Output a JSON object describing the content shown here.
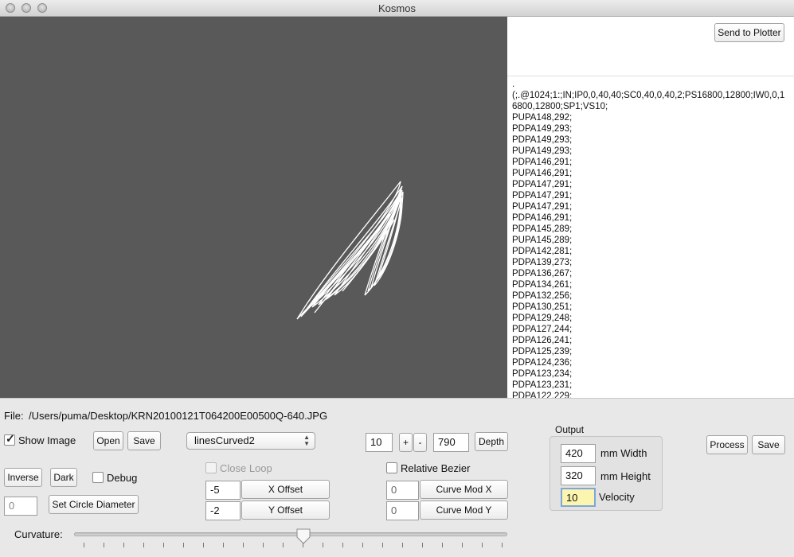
{
  "window": {
    "title": "Kosmos"
  },
  "canvas": {
    "background": "#595959",
    "stroke": "#ffffff"
  },
  "plotter": {
    "send_label": "Send to Plotter"
  },
  "hpgl_output": ".\n(;.@1024;1:;IN;IP0,0,40,40;SC0,40,0,40,2;PS16800,12800;IW0,0,16800,12800;SP1;VS10;\nPUPA148,292;\nPDPA149,293;\nPDPA149,293;\nPUPA149,293;\nPDPA146,291;\nPUPA146,291;\nPDPA147,291;\nPDPA147,291;\nPUPA147,291;\nPDPA146,291;\nPDPA145,289;\nPUPA145,289;\nPDPA142,281;\nPDPA139,273;\nPDPA136,267;\nPDPA134,261;\nPDPA132,256;\nPDPA130,251;\nPDPA129,248;\nPDPA127,244;\nPDPA126,241;\nPDPA125,239;\nPDPA124,236;\nPDPA123,234;\nPDPA123,231;\nPDPA122,229;",
  "file": {
    "label": "File:",
    "path": "/Users/puma/Desktop/KRN20100121T064200E00500Q-640.JPG"
  },
  "controls": {
    "show_image_label": "Show Image",
    "show_image_checked": true,
    "open_label": "Open",
    "save_label": "Save",
    "mode_selected": "linesCurved2",
    "depth_value": "10",
    "plus_label": "+",
    "minus_label": "-",
    "depth_second_value": "790",
    "depth_label": "Depth",
    "inverse_label": "Inverse",
    "dark_label": "Dark",
    "debug_label": "Debug",
    "debug_checked": false,
    "close_loop_label": "Close Loop",
    "close_loop_checked": false,
    "relative_bezier_label": "Relative Bezier",
    "relative_bezier_checked": false,
    "circle_value": "0",
    "set_circle_label": "Set Circle Diameter",
    "x_offset_value": "-5",
    "x_offset_label": "X Offset",
    "y_offset_value": "-2",
    "y_offset_label": "Y Offset",
    "curve_mod_x_value": "0",
    "curve_mod_x_label": "Curve Mod X",
    "curve_mod_y_value": "0",
    "curve_mod_y_label": "Curve Mod Y",
    "curvature_label": "Curvature:",
    "curvature_level": 0.53
  },
  "output": {
    "title": "Output",
    "width_value": "420",
    "width_label": "mm Width",
    "height_value": "320",
    "height_label": "mm Height",
    "velocity_value": "10",
    "velocity_label": "Velocity",
    "velocity_highlight": "#fcf5b0"
  },
  "actions": {
    "process_label": "Process",
    "save_label": "Save"
  }
}
